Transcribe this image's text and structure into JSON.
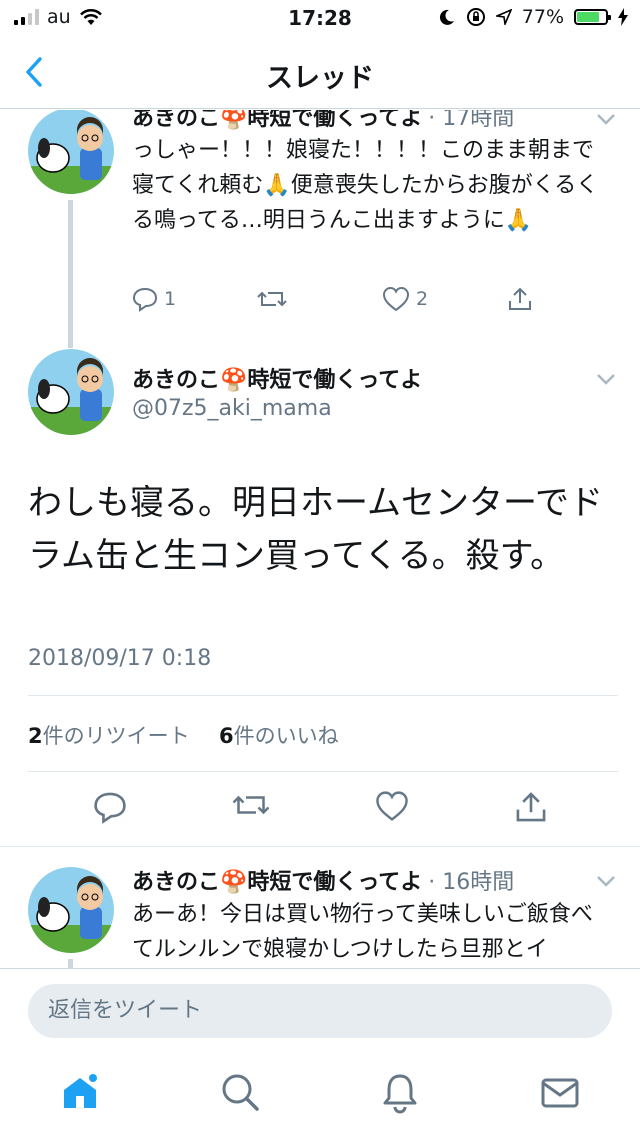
{
  "status": {
    "carrier": "au",
    "time": "17:28",
    "battery": "77%",
    "battery_level": 0.77
  },
  "nav": {
    "title": "スレッド"
  },
  "tweets": [
    {
      "name": "あきのこ🍄時短で働くってよ",
      "meta": "· 17時間",
      "text": "っしゃー！！！娘寝た！！！！このまま朝まで寝てくれ頼む🙏便意喪失したからお腹がくるくる鳴ってる…明日うんこ出ますように🙏",
      "reply_count": "1",
      "retweet_count": "",
      "like_count": "2"
    }
  ],
  "main_tweet": {
    "name": "あきのこ🍄時短で働くってよ",
    "handle": "@07z5_aki_mama",
    "text": "わしも寝る。明日ホームセンターでドラム缶と生コン買ってくる。殺す。",
    "datetime": "2018/09/17 0:18",
    "retweets_num": "2",
    "retweets_label": "件のリツイート",
    "likes_num": "6",
    "likes_label": "件のいいね"
  },
  "reply_tweet": {
    "name": "あきのこ🍄時短で働くってよ",
    "meta": "· 16時間",
    "text": "あーあ！今日は買い物行って美味しいご飯食べてルンルンで娘寝かしつけしたら旦那とイ"
  },
  "reply_bar": {
    "placeholder": "返信をツイート"
  },
  "colors": {
    "accent": "#1da1f2",
    "muted": "#657786",
    "divider": "#e1e8ed"
  },
  "tabs": [
    "home-icon",
    "search-icon",
    "notifications-icon",
    "messages-icon"
  ]
}
